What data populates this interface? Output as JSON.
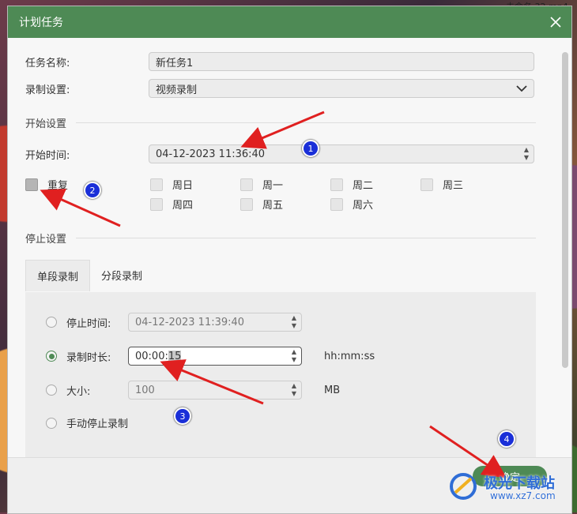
{
  "background": {
    "corner_text": "未命名 32 mp4"
  },
  "dialog": {
    "title": "计划任务",
    "task_name": {
      "label": "任务名称:",
      "value": "新任务1"
    },
    "record_setting": {
      "label": "录制设置:",
      "value": "视频录制"
    },
    "start_section": "开始设置",
    "start_time": {
      "label": "开始时间:",
      "value": "04-12-2023 11:36:40"
    },
    "repeat": {
      "label": "重复",
      "checked": false
    },
    "days": [
      "周日",
      "周一",
      "周二",
      "周三",
      "周四",
      "周五",
      "周六"
    ],
    "stop_section": "停止设置",
    "tabs": [
      {
        "label": "单段录制",
        "active": true
      },
      {
        "label": "分段录制",
        "active": false
      }
    ],
    "stop_time": {
      "label": "停止时间:",
      "value": "04-12-2023 11:39:40"
    },
    "duration": {
      "label": "录制时长:",
      "value_prefix": "00:00:",
      "value_sel": "15",
      "unit": "hh:mm:ss"
    },
    "size": {
      "label": "大小:",
      "value": "100",
      "unit": "MB"
    },
    "manual_stop": {
      "label": "手动停止录制"
    },
    "ok_label": "确定"
  },
  "annotations": {
    "badges": [
      "1",
      "2",
      "3",
      "4"
    ],
    "arrow_color": "#e02020",
    "badge_color": "#1a2fd8"
  },
  "watermark": {
    "brand": "极光下载站",
    "url": "www.xz7.com"
  }
}
